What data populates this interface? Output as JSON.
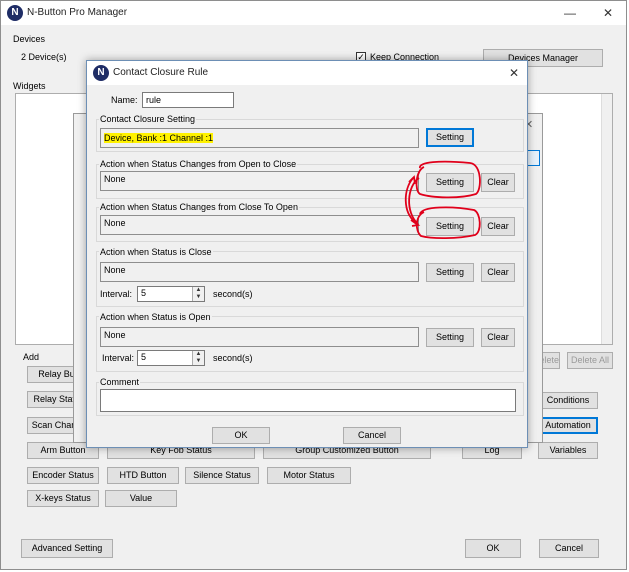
{
  "main_window": {
    "title": "N-Button Pro Manager",
    "app_icon": "N",
    "devices_label": "Devices",
    "device_count": "2 Device(s)",
    "keep_connection_label": "Keep Connection",
    "keep_connection_checked": true,
    "devices_manager_button": "Devices Manager",
    "widgets_label": "Widgets",
    "add_label": "Add",
    "add_buttons": [
      "Relay Butt",
      "Relay Status",
      "Scan Channe",
      "Arm Button",
      "Key Fob Status",
      "Group Customized Button",
      "Encoder Status",
      "HTD Button",
      "Silence Status",
      "Motor Status",
      "X-keys Status",
      "Value"
    ],
    "right_buttons": [
      "Delete",
      "Delete All",
      "Conditions",
      "Automation",
      "Log",
      "Variables"
    ],
    "advanced_setting_button": "Advanced Setting",
    "ok_button": "OK",
    "cancel_button": "Cancel"
  },
  "dialog": {
    "title": "Contact Closure Rule",
    "name_label": "Name:",
    "name_value": "rule",
    "contact_closure_label": "Contact Closure Setting",
    "contact_closure_value": "Device, Bank :1 Channel :1",
    "sections": [
      {
        "label": "Action when Status Changes from Open to Close",
        "value": "None"
      },
      {
        "label": "Action when Status Changes from Close To Open",
        "value": "None"
      },
      {
        "label": "Action when Status is Close",
        "value": "None",
        "interval_label": "Interval:",
        "interval_value": "5",
        "unit": "second(s)"
      },
      {
        "label": "Action when Status is Open",
        "value": "None",
        "interval_label": "Interval:",
        "interval_value": "5",
        "unit": "second(s)"
      }
    ],
    "setting_button": "Setting",
    "clear_button": "Clear",
    "comment_label": "Comment",
    "comment_value": "",
    "ok_button": "OK",
    "cancel_button": "Cancel"
  },
  "annotation_colors": {
    "highlight": "#fff200",
    "pen": "#e0001b"
  }
}
